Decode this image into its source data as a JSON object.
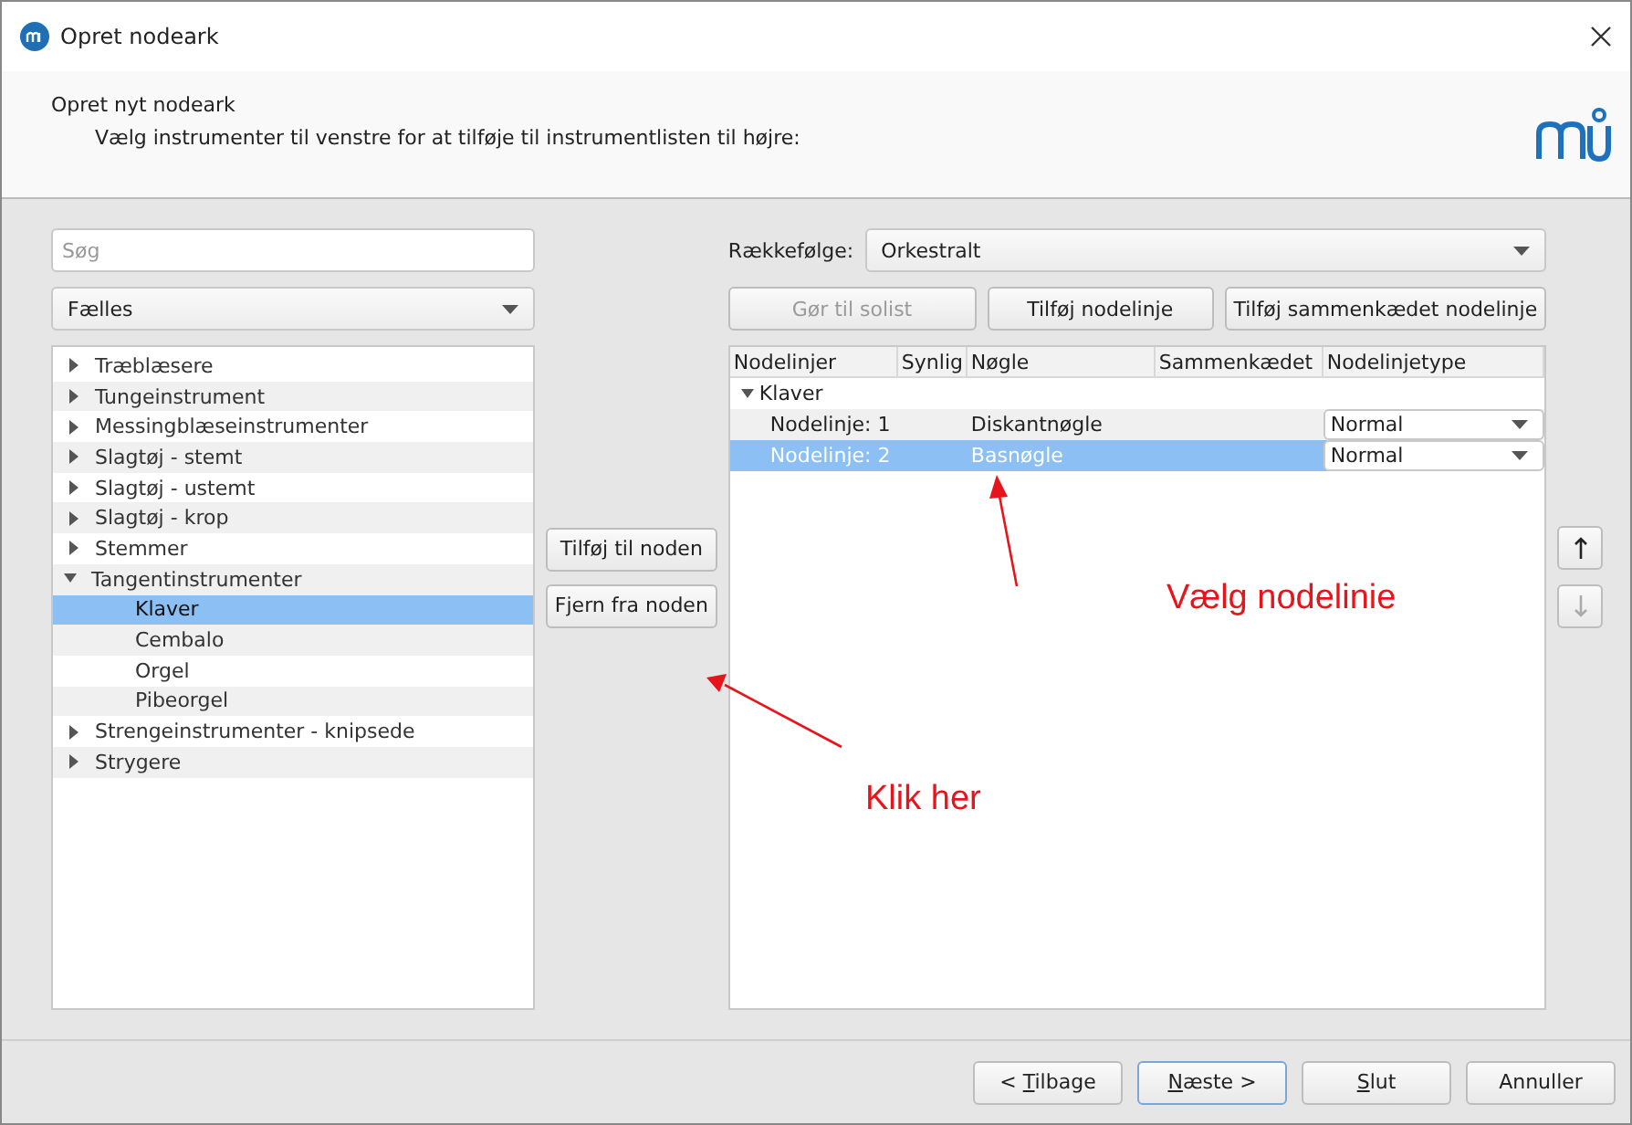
{
  "window": {
    "title": "Opret nodeark"
  },
  "header": {
    "title": "Opret nyt nodeark",
    "subtitle": "Vælg instrumenter til venstre for at tilføje til instrumentlisten til højre:"
  },
  "instruments": {
    "search": {
      "placeholder": "Søg"
    },
    "group": "Fælles",
    "tree": [
      {
        "label": "Træblæsere",
        "expanded": false,
        "selected": false
      },
      {
        "label": "Tungeinstrument",
        "expanded": false,
        "selected": false
      },
      {
        "label": "Messingblæseinstrumenter",
        "expanded": false,
        "selected": false
      },
      {
        "label": "Slagtøj - stemt",
        "expanded": false,
        "selected": false
      },
      {
        "label": "Slagtøj - ustemt",
        "expanded": false,
        "selected": false
      },
      {
        "label": "Slagtøj - krop",
        "expanded": false,
        "selected": false
      },
      {
        "label": "Stemmer",
        "expanded": false,
        "selected": false
      },
      {
        "label": "Tangentinstrumenter",
        "expanded": true,
        "selected": false,
        "children": [
          {
            "label": "Klaver",
            "selected": true
          },
          {
            "label": "Cembalo",
            "selected": false
          },
          {
            "label": "Orgel",
            "selected": false
          },
          {
            "label": "Pibeorgel",
            "selected": false
          }
        ]
      },
      {
        "label": "Strengeinstrumenter - knipsede",
        "expanded": false,
        "selected": false
      },
      {
        "label": "Strygere",
        "expanded": false,
        "selected": false
      }
    ]
  },
  "transfer_buttons": [
    {
      "label": "Tilføj til noden"
    },
    {
      "label": "Fjern fra noden"
    }
  ],
  "score": {
    "order_label": "Rækkefølge:",
    "order": "Orkestralt",
    "buttons": [
      {
        "label": "Gør til solist",
        "disabled": true
      },
      {
        "label": "Tilføj nodelinje",
        "disabled": false
      },
      {
        "label": "Tilføj sammenkædet nodelinje",
        "disabled": false
      }
    ],
    "columns": [
      "Nodelinjer",
      "Synlig",
      "Nøgle",
      "Sammenkædet",
      "Nodelinjetype"
    ],
    "instruments": [
      {
        "name": "Klaver",
        "expanded": true,
        "staves": [
          {
            "name": "Nodelinje: 1",
            "clef": "Diskantnøgle",
            "type": "Normal",
            "selected": false
          },
          {
            "name": "Nodelinje: 2",
            "clef": "Basnøgle",
            "type": "Normal",
            "selected": true
          }
        ]
      }
    ]
  },
  "move_buttons": [
    {
      "kind": "up",
      "disabled": false
    },
    {
      "kind": "down",
      "disabled": true
    }
  ],
  "annotations": [
    {
      "text": "Vælg nodelinie"
    },
    {
      "text": "Klik her"
    }
  ],
  "footer_buttons": [
    {
      "before": "< ",
      "key": "T",
      "after": "ilbage",
      "default": false
    },
    {
      "key": "N",
      "after": "æste >",
      "default": true
    },
    {
      "key": "S",
      "after": "lut",
      "default": false
    },
    {
      "before": "Annuller",
      "default": false
    }
  ]
}
